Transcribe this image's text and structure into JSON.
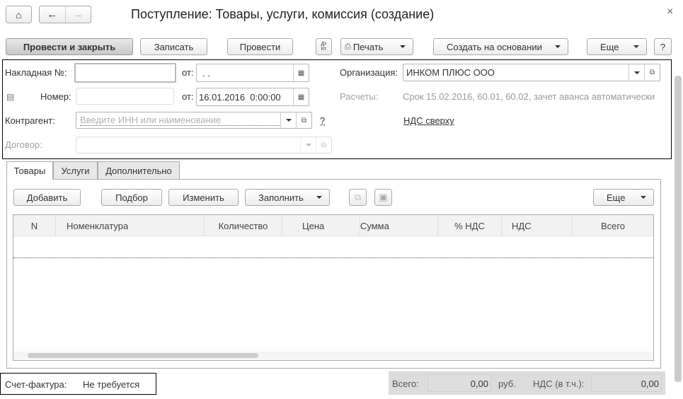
{
  "window": {
    "title": "Поступление: Товары, услуги, комиссия (создание)",
    "close": "×"
  },
  "toolbar": {
    "post_close": "Провести и закрыть",
    "save": "Записать",
    "post": "Провести",
    "dtkt": "ДтКт",
    "print": "Печать",
    "create_based": "Создать на основании",
    "more": "Еще",
    "help": "?"
  },
  "header": {
    "invoice_label": "Накладная  №:",
    "invoice_number": "",
    "from_label": "от:",
    "invoice_date": " .  .",
    "number_label": "Номер:",
    "number_value": "",
    "date_value": "16.01.2016  0:00:00",
    "counterparty_label": "Контрагент:",
    "counterparty_placeholder": "Введите ИНН или наименование",
    "help": "?",
    "contract_label": "Договор:",
    "org_label": "Организация:",
    "org_value": "ИНКОМ ПЛЮС ООО",
    "settlements_label": "Расчеты:",
    "settlements_value": "Срок 15.02.2016, 60.01, 60.02, зачет аванса автоматически",
    "vat_link": "НДС сверху"
  },
  "tabs": [
    {
      "label": "Товары",
      "active": true
    },
    {
      "label": "Услуги"
    },
    {
      "label": "Дополнительно"
    }
  ],
  "table_toolbar": {
    "add": "Добавить",
    "pick": "Подбор",
    "edit": "Изменить",
    "fill": "Заполнить",
    "more": "Еще"
  },
  "table": {
    "columns": [
      "N",
      "Номенклатура",
      "Количество",
      "Цена",
      "Сумма",
      "% НДС",
      "НДС",
      "Всего"
    ],
    "rows": []
  },
  "footer": {
    "invoice_label": "Счет-фактура:",
    "invoice_value": "Не требуется",
    "total_label": "Всего:",
    "total_value": "0,00",
    "currency": "руб.",
    "vat_label": "НДС (в т.ч.):",
    "vat_value": "0,00"
  }
}
